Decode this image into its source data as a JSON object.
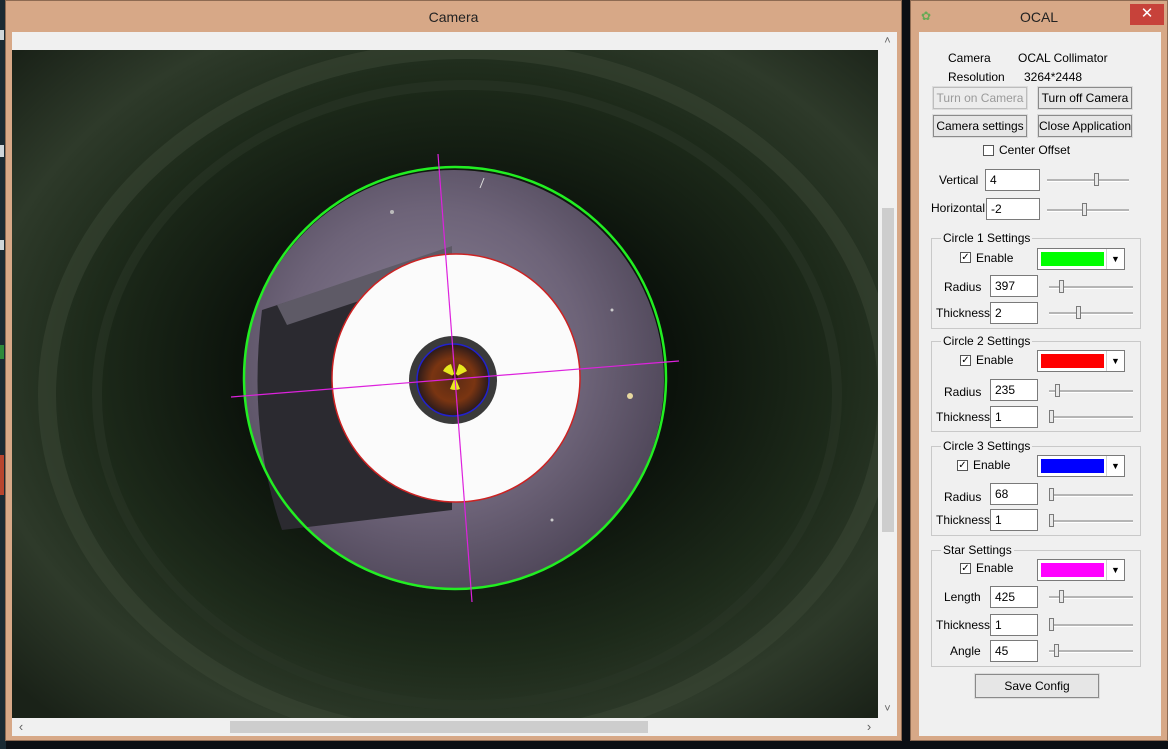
{
  "camera_window": {
    "title": "Camera",
    "overlay": {
      "circle1_color": "#22ee22",
      "circle2_color": "#cc2222",
      "circle3_color": "#2222cc",
      "star_color": "#dd22dd"
    }
  },
  "ocal_window": {
    "title": "OCAL",
    "close_glyph": "✕",
    "info": {
      "camera_label": "Camera",
      "camera_value": "OCAL Collimator",
      "resolution_label": "Resolution",
      "resolution_value": "3264*2448"
    },
    "buttons": {
      "turn_on": "Turn on Camera",
      "turn_off": "Turn off Camera",
      "camera_settings": "Camera settings",
      "close_app": "Close Application",
      "save_config": "Save Config"
    },
    "center_offset": {
      "label": "Center Offset",
      "checked": false,
      "vertical_label": "Vertical",
      "vertical_value": "4",
      "horizontal_label": "Horizontal",
      "horizontal_value": "-2"
    },
    "circle1": {
      "title": "Circle 1 Settings",
      "enable_label": "Enable",
      "enabled": true,
      "color": "#00ff00",
      "radius_label": "Radius",
      "radius_value": "397",
      "thickness_label": "Thickness",
      "thickness_value": "2"
    },
    "circle2": {
      "title": "Circle 2 Settings",
      "enable_label": "Enable",
      "enabled": true,
      "color": "#ff0000",
      "radius_label": "Radius",
      "radius_value": "235",
      "thickness_label": "Thickness",
      "thickness_value": "1"
    },
    "circle3": {
      "title": "Circle 3 Settings",
      "enable_label": "Enable",
      "enabled": true,
      "color": "#0000ff",
      "radius_label": "Radius",
      "radius_value": "68",
      "thickness_label": "Thickness",
      "thickness_value": "1"
    },
    "star": {
      "title": "Star Settings",
      "enable_label": "Enable",
      "enabled": true,
      "color": "#ff00ff",
      "length_label": "Length",
      "length_value": "425",
      "thickness_label": "Thickness",
      "thickness_value": "1",
      "angle_label": "Angle",
      "angle_value": "45"
    }
  }
}
